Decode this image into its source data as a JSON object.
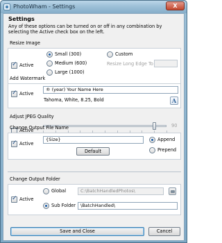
{
  "window": {
    "title": "PhotoWham - Settings",
    "close_label": "X"
  },
  "heading": "Settings",
  "description": "Any of these options can be turned on or off in any combination by selecting the Active check box on the left.",
  "resize": {
    "title": "Resize Image",
    "active_label": "Active",
    "active": true,
    "options": [
      "Small (300)",
      "Medium (600)",
      "Large (1000)"
    ],
    "selected": "Small (300)",
    "custom_label": "Custom",
    "long_edge_label": "Resize Long Edge To",
    "long_edge_value": ""
  },
  "watermark": {
    "title": "Add Watermark",
    "active_label": "Active",
    "active": true,
    "text": "® (year) Your Name Here",
    "font_info": "Tahoma, White, 8.25, Bold",
    "font_button_label": "A"
  },
  "jpeg": {
    "title": "Adjust JPEG Quality",
    "active_label": "Active",
    "active": false,
    "value": "90",
    "value_fraction": 0.9
  },
  "rename": {
    "title": "Change Output File Name",
    "active_label": "Active",
    "active": true,
    "value": "{Size}",
    "default_button": "Default",
    "options": [
      "Append",
      "Prepend"
    ],
    "selected": "Append"
  },
  "folder": {
    "title": "Change Output Folder",
    "active_label": "Active",
    "active": true,
    "global_label": "Global",
    "global_value": "C:\\BatchHandledPhotos\\",
    "subfolder_label": "Sub Folder",
    "subfolder_value": "\\BatchHandled\\",
    "selected": "Sub Folder"
  },
  "footer": {
    "save_label": "Save and Close",
    "cancel_label": "Cancel"
  }
}
